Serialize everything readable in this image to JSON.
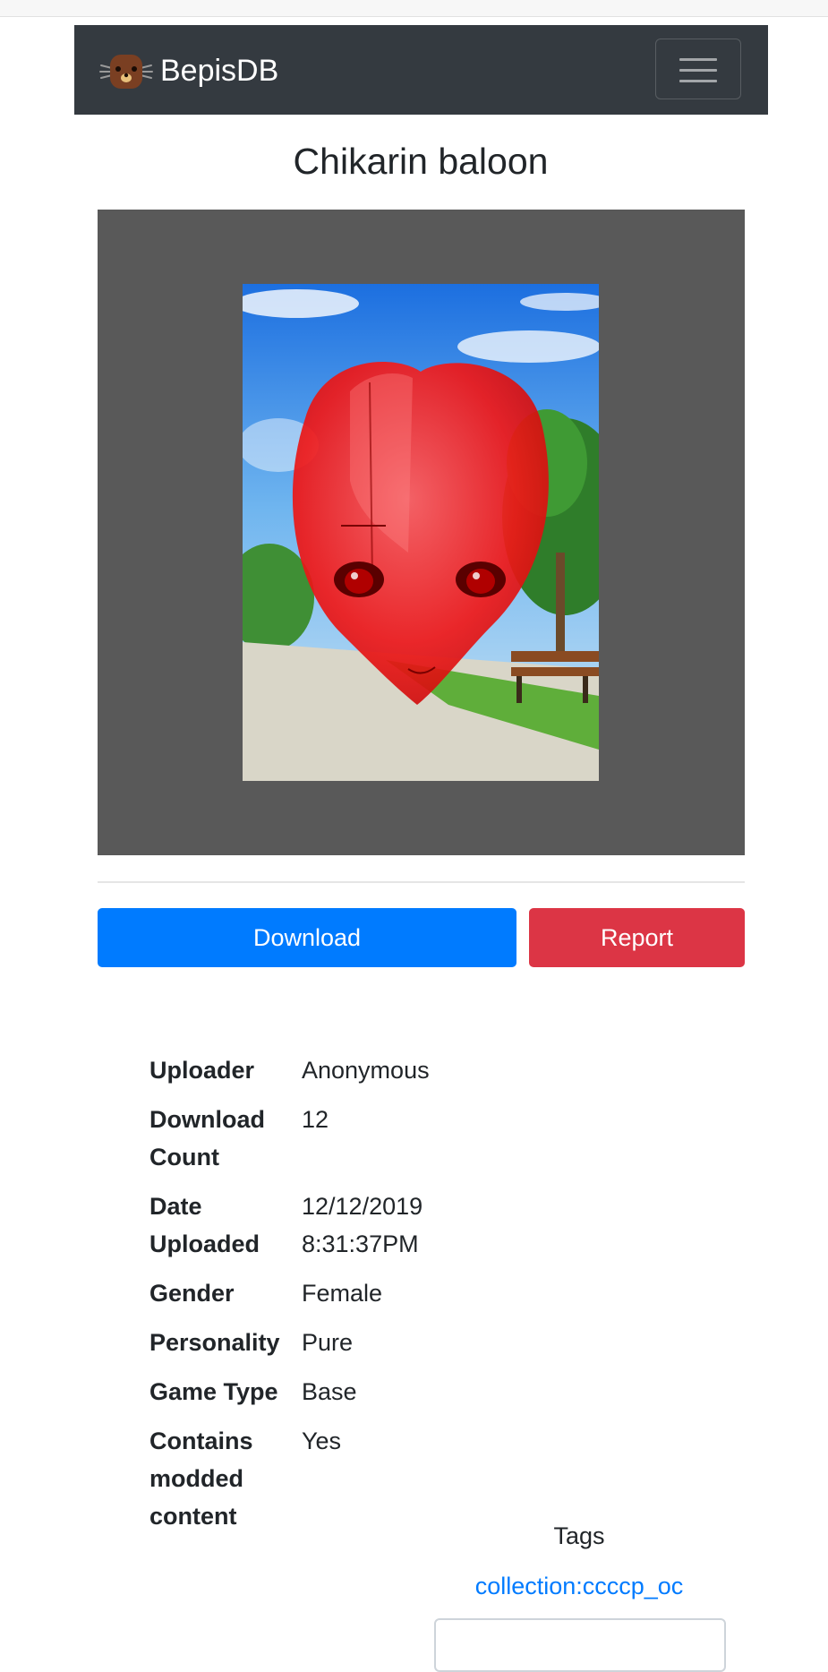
{
  "navbar": {
    "brand": "BepisDB",
    "logo_icon": "bepis-mascot-icon",
    "toggle_icon": "hamburger-menu-icon",
    "bg_color": "#343a40"
  },
  "card": {
    "title": "Chikarin baloon",
    "preview_bg": "#595959"
  },
  "actions": {
    "download_label": "Download",
    "download_color": "#007bff",
    "report_label": "Report",
    "report_color": "#dc3545"
  },
  "info": [
    {
      "key": "Uploader",
      "value": "Anonymous"
    },
    {
      "key": "Download Count",
      "value": "12"
    },
    {
      "key": "Date Uploaded",
      "value": "12/12/2019 8:31:37PM"
    },
    {
      "key": "Gender",
      "value": "Female"
    },
    {
      "key": "Personality",
      "value": "Pure"
    },
    {
      "key": "Game Type",
      "value": "Base"
    },
    {
      "key": "Contains modded content",
      "value": "Yes"
    }
  ],
  "tags": {
    "heading": "Tags",
    "items": [
      "collection:ccccp_oc"
    ]
  }
}
